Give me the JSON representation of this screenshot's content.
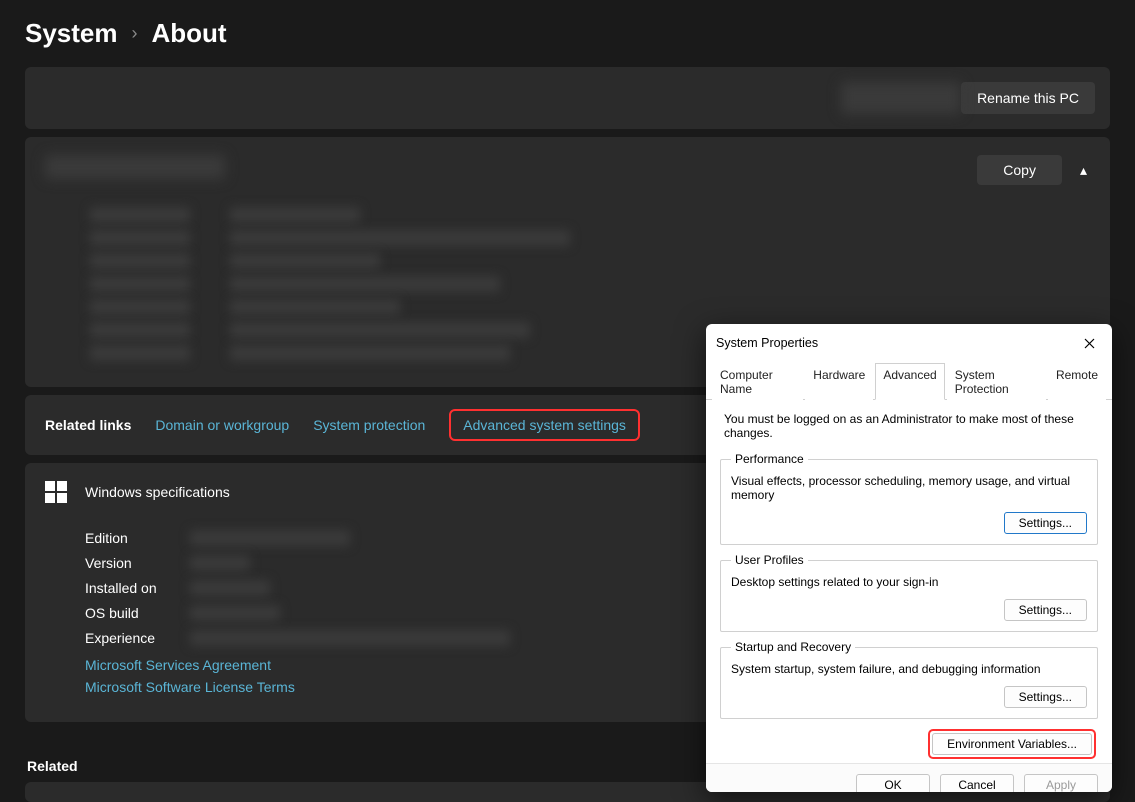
{
  "breadcrumb": {
    "parent": "System",
    "current": "About"
  },
  "device_panel": {
    "rename_btn": "Rename this PC"
  },
  "specs_panel": {
    "copy_btn": "Copy"
  },
  "related_links": {
    "label": "Related links",
    "domain": "Domain or workgroup",
    "protection": "System protection",
    "advanced": "Advanced system settings"
  },
  "winspec": {
    "heading": "Windows specifications",
    "rows": {
      "edition": "Edition",
      "version": "Version",
      "installed": "Installed on",
      "osbuild": "OS build",
      "experience": "Experience"
    },
    "link_services": "Microsoft Services Agreement",
    "link_license": "Microsoft Software License Terms"
  },
  "related_heading": "Related",
  "dialog": {
    "title": "System Properties",
    "tabs": {
      "computer_name": "Computer Name",
      "hardware": "Hardware",
      "advanced": "Advanced",
      "system_protection": "System Protection",
      "remote": "Remote"
    },
    "note": "You must be logged on as an Administrator to make most of these changes.",
    "perf": {
      "legend": "Performance",
      "desc": "Visual effects, processor scheduling, memory usage, and virtual memory",
      "btn": "Settings..."
    },
    "profiles": {
      "legend": "User Profiles",
      "desc": "Desktop settings related to your sign-in",
      "btn": "Settings..."
    },
    "startup": {
      "legend": "Startup and Recovery",
      "desc": "System startup, system failure, and debugging information",
      "btn": "Settings..."
    },
    "envvar_btn": "Environment Variables...",
    "footer": {
      "ok": "OK",
      "cancel": "Cancel",
      "apply": "Apply"
    }
  }
}
